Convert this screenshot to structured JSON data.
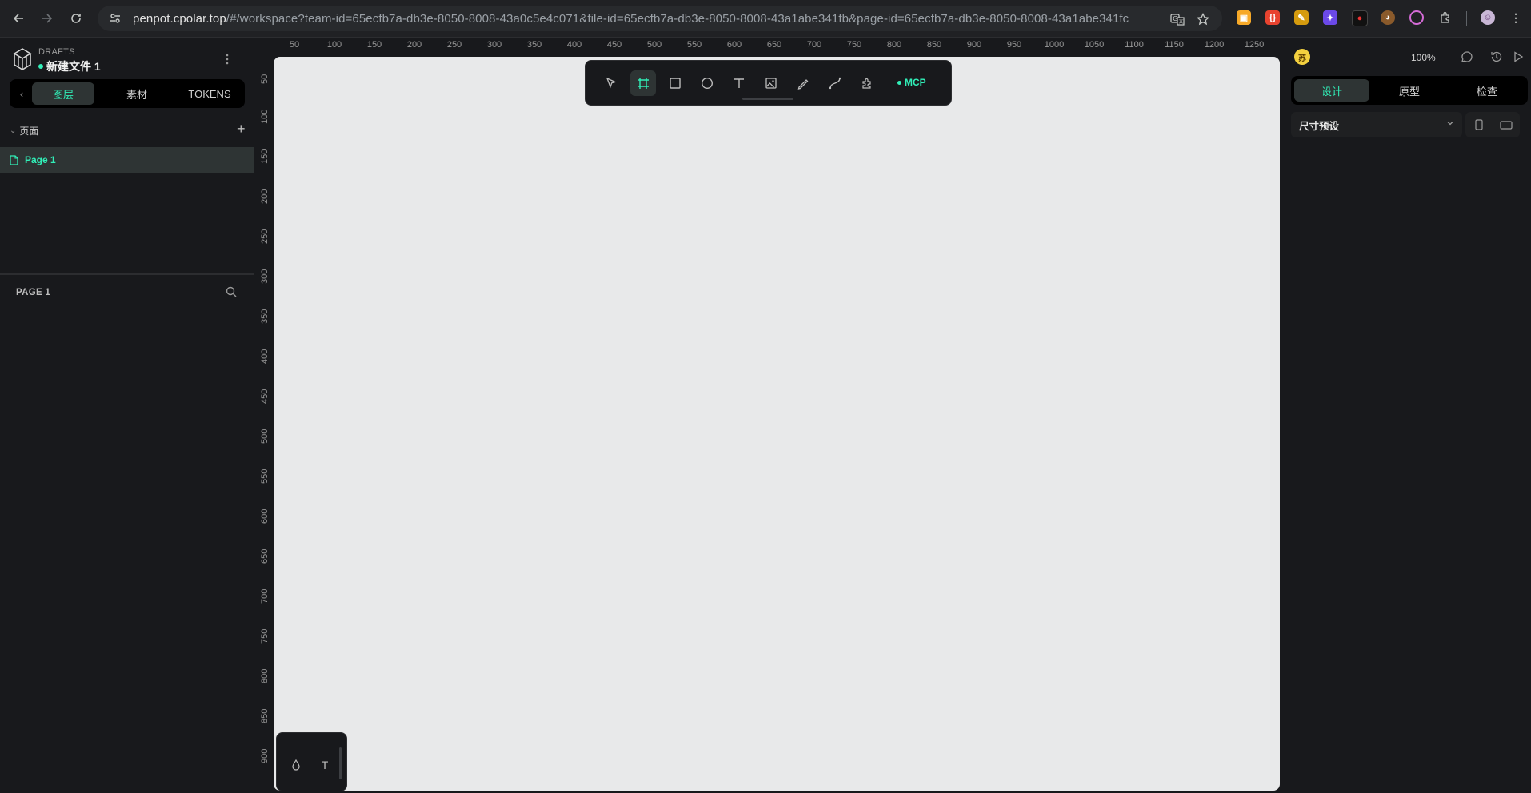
{
  "browser": {
    "url_host": "penpot.cpolar.top",
    "url_path": "/#/workspace?team-id=65ecfb7a-db3e-8050-8008-43a0c5e4c071&file-id=65ecfb7a-db3e-8050-8008-43a1abe341fb&page-id=65ecfb7a-db3e-8050-8008-43a1abe341fc",
    "icons": [
      "back-icon",
      "forward-icon",
      "reload-icon",
      "site-info-icon",
      "translate-icon",
      "bookmark-star-icon",
      "extensions-icon",
      "profile-avatar"
    ]
  },
  "project": {
    "label": "DRAFTS",
    "file_name": "新建文件 1",
    "accent": "#31efb8"
  },
  "left_tabs": {
    "collapse": "‹",
    "layers": "图层",
    "assets": "素材",
    "tokens": "TOKENS"
  },
  "pages": {
    "header": "页面",
    "add": "+",
    "items": [
      {
        "label": "Page 1"
      }
    ]
  },
  "layers": {
    "title": "PAGE 1"
  },
  "rulers": {
    "top": [
      "50",
      "100",
      "150",
      "200",
      "250",
      "300",
      "350",
      "400",
      "450",
      "500",
      "550",
      "600",
      "650",
      "700",
      "750",
      "800",
      "850",
      "900",
      "950",
      "1000",
      "1050",
      "1100",
      "1150",
      "1200",
      "1250"
    ],
    "left": [
      "50",
      "100",
      "150",
      "200",
      "250",
      "300",
      "350",
      "400",
      "450",
      "500",
      "550",
      "600",
      "650",
      "700",
      "750",
      "800",
      "850",
      "900"
    ]
  },
  "toolbar": {
    "tools": [
      "move-tool-icon",
      "board-tool-icon",
      "rectangle-tool-icon",
      "ellipse-tool-icon",
      "text-tool-icon",
      "image-tool-icon",
      "curve-tool-icon",
      "path-tool-icon",
      "plugins-icon"
    ],
    "mcp_label": "MCP"
  },
  "mini_toolbar": {
    "text_icon": "T"
  },
  "right_panel": {
    "avatar_text": "苏",
    "zoom": "100%",
    "tabs": {
      "design": "设计",
      "prototype": "原型",
      "inspect": "检查"
    },
    "size_preset_label": "尺寸预设"
  }
}
